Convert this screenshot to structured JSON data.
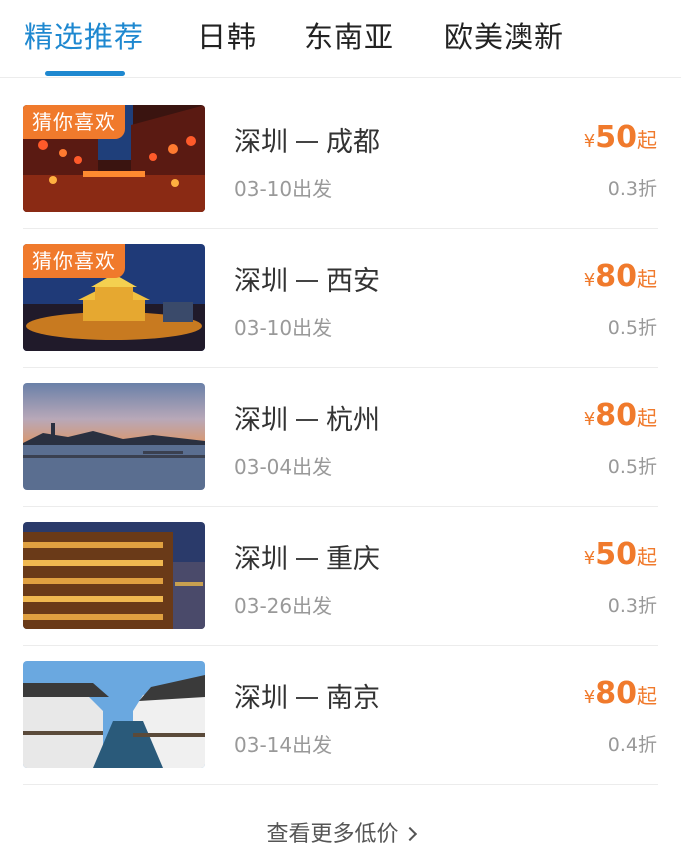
{
  "tabs": [
    {
      "label": "精选推荐",
      "active": true
    },
    {
      "label": "日韩",
      "active": false
    },
    {
      "label": "东南亚",
      "active": false
    },
    {
      "label": "欧美澳新",
      "active": false
    }
  ],
  "colors": {
    "accent": "#1e88d0",
    "price": "#f07a2c",
    "tag": "#f07a2c"
  },
  "deals": [
    {
      "tag": "猜你喜欢",
      "from": "深圳",
      "to": "成都",
      "date": "03-10出发",
      "currency": "¥",
      "price": "50",
      "suffix": "起",
      "discount": "0.3折",
      "image": "chengdu-night-lanterns"
    },
    {
      "tag": "猜你喜欢",
      "from": "深圳",
      "to": "西安",
      "date": "03-10出发",
      "currency": "¥",
      "price": "80",
      "suffix": "起",
      "discount": "0.5折",
      "image": "xian-drum-tower-night"
    },
    {
      "tag": "",
      "from": "深圳",
      "to": "杭州",
      "date": "03-04出发",
      "currency": "¥",
      "price": "80",
      "suffix": "起",
      "discount": "0.5折",
      "image": "hangzhou-west-lake-dusk"
    },
    {
      "tag": "",
      "from": "深圳",
      "to": "重庆",
      "date": "03-26出发",
      "currency": "¥",
      "price": "50",
      "suffix": "起",
      "discount": "0.3折",
      "image": "chongqing-hongyadong"
    },
    {
      "tag": "",
      "from": "深圳",
      "to": "南京",
      "date": "03-14出发",
      "currency": "¥",
      "price": "80",
      "suffix": "起",
      "discount": "0.4折",
      "image": "water-town-canal"
    }
  ],
  "footer": {
    "more_label": "查看更多低价"
  }
}
